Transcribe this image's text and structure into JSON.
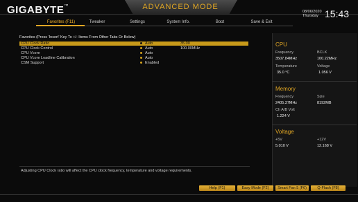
{
  "header": {
    "brand": "GIGABYTE",
    "brand_tm": "™",
    "mode_title": "ADVANCED MODE",
    "date": "08/06/2020",
    "day": "Thursday",
    "time": "15:43"
  },
  "tabs": [
    {
      "label": "Favorites (F11)",
      "active": true
    },
    {
      "label": "Tweaker",
      "active": false
    },
    {
      "label": "Settings",
      "active": false
    },
    {
      "label": "System Info.",
      "active": false
    },
    {
      "label": "Boot",
      "active": false
    },
    {
      "label": "Save & Exit",
      "active": false
    }
  ],
  "main": {
    "section_title": "Favorites (Press 'Insert' Key To +/- Items From Other Tabs Or Below)",
    "rows": [
      {
        "label": "CPU Clock Ratio",
        "value": "Auto",
        "extra": "35.00",
        "selected": true
      },
      {
        "label": "CPU Clock Control",
        "value": "Auto",
        "extra": "100.00MHz",
        "selected": false
      },
      {
        "label": "CPU Vcore",
        "value": "Auto",
        "extra": "",
        "selected": false
      },
      {
        "label": "CPU Vcore Loadline Calibration",
        "value": "Auto",
        "extra": "",
        "selected": false
      },
      {
        "label": "CSM Support",
        "value": "Enabled",
        "extra": "",
        "selected": false
      }
    ],
    "hint": "Adjusting CPU Clock ratio will affect the CPU clock frequency, temperature and voltage requirements."
  },
  "right_panel": {
    "cpu": {
      "title": "CPU",
      "freq_label": "Frequency",
      "freq_value": "3507.84MHz",
      "bclk_label": "BCLK",
      "bclk_value": "100.22MHz",
      "temp_label": "Temperature",
      "temp_value": "35.0 °C",
      "volt_label": "Voltage",
      "volt_value": "1.056 V"
    },
    "memory": {
      "title": "Memory",
      "freq_label": "Frequency",
      "freq_value": "2405.37MHz",
      "size_label": "Size",
      "size_value": "8192MB",
      "volt_label": "Ch A/B Volt",
      "volt_value": "1.224 V"
    },
    "voltage": {
      "title": "Voltage",
      "v5_label": "+5V",
      "v5_value": "5.010 V",
      "v12_label": "+12V",
      "v12_value": "12.168 V"
    }
  },
  "footer": {
    "help": "Help (F1)",
    "easy": "Easy Mode (F2)",
    "smartfan": "Smart Fan 5 (F6)",
    "qflash": "Q-Flash (F8)"
  },
  "colors": {
    "accent": "#e0a624",
    "background": "#0b0b0b",
    "selection": "#c89a1a"
  }
}
